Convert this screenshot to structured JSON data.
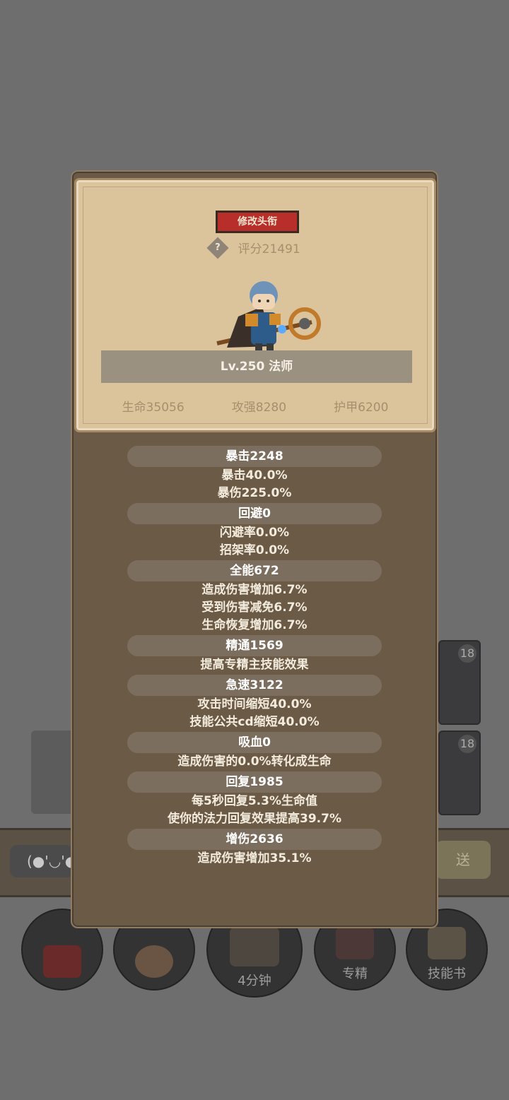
{
  "background": {
    "chat_placeholder": "(●'◡'●",
    "send_label": "送",
    "skill_cards": [
      {
        "level": "18"
      },
      {
        "level": "18"
      }
    ],
    "bottom_buttons": [
      {
        "label": "",
        "icon": "potion-icon"
      },
      {
        "label": "",
        "icon": "bread-icon"
      },
      {
        "label": "4分钟",
        "icon": "chest-icon"
      },
      {
        "label": "专精",
        "icon": "specialize-icon"
      },
      {
        "label": "技能书",
        "icon": "skillbook-icon"
      }
    ]
  },
  "header": {
    "edit_title_label": "修改头衔",
    "score": "评分21491",
    "level_class": "Lv.250 法师",
    "basic_stats": [
      "生命35056",
      "攻强8280",
      "护甲6200"
    ]
  },
  "stats": [
    {
      "head": "暴击2248",
      "lines": [
        "暴击40.0%",
        "暴伤225.0%"
      ]
    },
    {
      "head": "回避0",
      "lines": [
        "闪避率0.0%",
        "招架率0.0%"
      ]
    },
    {
      "head": "全能672",
      "lines": [
        "造成伤害增加6.7%",
        "受到伤害减免6.7%",
        "生命恢复增加6.7%"
      ]
    },
    {
      "head": "精通1569",
      "lines": [
        "提高专精主技能效果"
      ]
    },
    {
      "head": "急速3122",
      "lines": [
        "攻击时间缩短40.0%",
        "技能公共cd缩短40.0%"
      ]
    },
    {
      "head": "吸血0",
      "lines": [
        "造成伤害的0.0%转化成生命"
      ]
    },
    {
      "head": "回复1985",
      "lines": [
        "每5秒回复5.3%生命值",
        "使你的法力回复效果提高39.7%"
      ]
    },
    {
      "head": "增伤2636",
      "lines": [
        "造成伤害增加35.1%"
      ]
    }
  ]
}
